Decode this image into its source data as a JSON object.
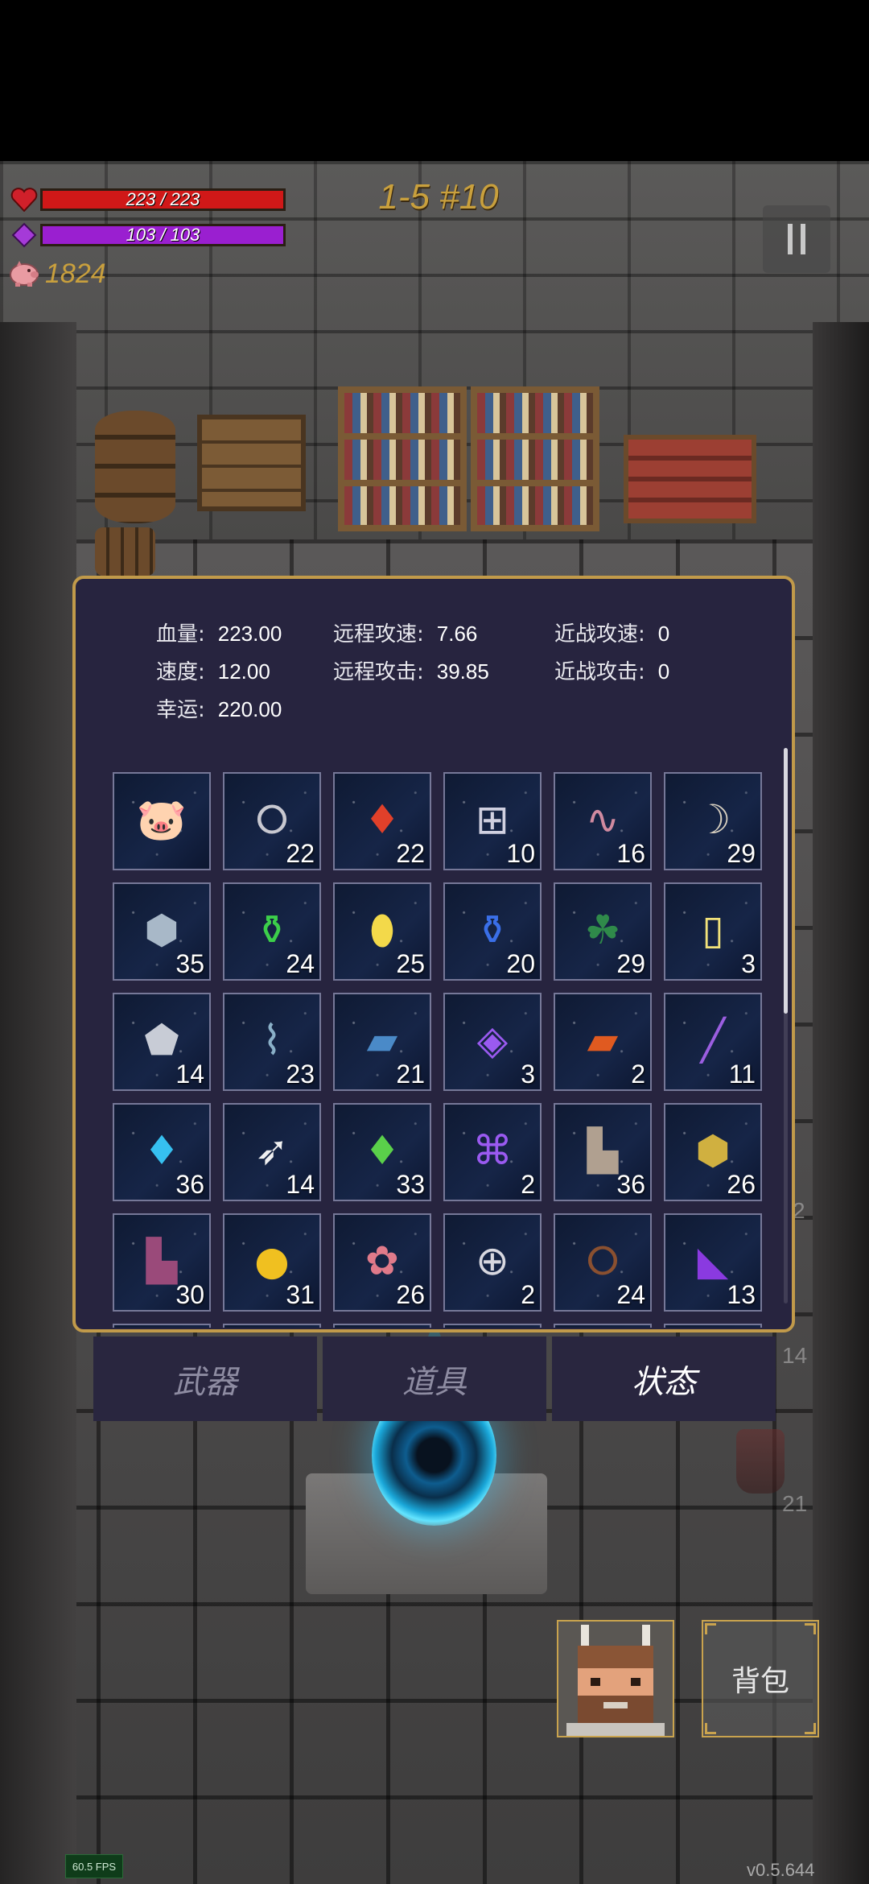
{
  "hud": {
    "hp": {
      "text": "223 / 223",
      "current": 223,
      "max": 223,
      "color": "#d01818"
    },
    "mp": {
      "text": "103 / 103",
      "current": 103,
      "max": 103,
      "color": "#9a1fd0"
    },
    "coins": "1824",
    "level": "1-5 #10"
  },
  "stats": {
    "hp_label": "血量:",
    "hp_value": "223.00",
    "speed_label": "速度:",
    "speed_value": "12.00",
    "luck_label": "幸运:",
    "luck_value": "220.00",
    "ranged_speed_label": "远程攻速:",
    "ranged_speed_value": "7.66",
    "ranged_atk_label": "远程攻击:",
    "ranged_atk_value": "39.85",
    "melee_speed_label": "近战攻速:",
    "melee_speed_value": "0",
    "melee_atk_label": "近战攻击:",
    "melee_atk_value": "0"
  },
  "inventory": [
    {
      "icon": "piggy-bank-icon",
      "glyph": "🐷",
      "count": ""
    },
    {
      "icon": "silver-rings-icon",
      "glyph": "⭘",
      "count": "22"
    },
    {
      "icon": "red-crystal-icon",
      "glyph": "♦",
      "count": "22"
    },
    {
      "icon": "medkit-frame-icon",
      "glyph": "⊞",
      "count": "10"
    },
    {
      "icon": "pink-worm-icon",
      "glyph": "∿",
      "count": "16"
    },
    {
      "icon": "horn-icon",
      "glyph": "☽",
      "count": "29"
    },
    {
      "icon": "grey-rock-icon",
      "glyph": "⬢",
      "count": "35"
    },
    {
      "icon": "green-potion-icon",
      "glyph": "⚱",
      "count": "24"
    },
    {
      "icon": "yellow-crystal-icon",
      "glyph": "⬮",
      "count": "25"
    },
    {
      "icon": "blue-potion-icon",
      "glyph": "⚱",
      "count": "20"
    },
    {
      "icon": "clover-icon",
      "glyph": "☘",
      "count": "29"
    },
    {
      "icon": "yellow-card-icon",
      "glyph": "▯",
      "count": "3"
    },
    {
      "icon": "silver-ore-icon",
      "glyph": "⬟",
      "count": "14"
    },
    {
      "icon": "glass-vial-icon",
      "glyph": "⌇",
      "count": "23"
    },
    {
      "icon": "blue-book-icon",
      "glyph": "▰",
      "count": "21"
    },
    {
      "icon": "purple-rune-eye-icon",
      "glyph": "◈",
      "count": "3"
    },
    {
      "icon": "red-book-icon",
      "glyph": "▰",
      "count": "2"
    },
    {
      "icon": "purple-wand-icon",
      "glyph": "╱",
      "count": "11"
    },
    {
      "icon": "cyan-crystal-icon",
      "glyph": "♦",
      "count": "36"
    },
    {
      "icon": "feather-icon",
      "glyph": "➶",
      "count": "14"
    },
    {
      "icon": "green-crystal-icon",
      "glyph": "♦",
      "count": "33"
    },
    {
      "icon": "purple-rune-icon",
      "glyph": "⌘",
      "count": "2"
    },
    {
      "icon": "boots-icon",
      "glyph": "▙",
      "count": "36"
    },
    {
      "icon": "gold-ore-icon",
      "glyph": "⬢",
      "count": "26"
    },
    {
      "icon": "purple-boots-icon",
      "glyph": "▙",
      "count": "30"
    },
    {
      "icon": "gold-coin-icon",
      "glyph": "●",
      "count": "31"
    },
    {
      "icon": "flower-wreath-icon",
      "glyph": "✿",
      "count": "26"
    },
    {
      "icon": "medkit-ring-icon",
      "glyph": "⊕",
      "count": "2"
    },
    {
      "icon": "thorn-crown-icon",
      "glyph": "⭘",
      "count": "24"
    },
    {
      "icon": "purple-shell-icon",
      "glyph": "◣",
      "count": "13"
    }
  ],
  "slot_colors": [
    "#f2a0b0",
    "#c8c8d0",
    "#e0402a",
    "#d0d0e0",
    "#d08aa0",
    "#d8d0c0",
    "#a8b8c8",
    "#3ccf4a",
    "#f3d94a",
    "#3a6fe8",
    "#2f8a4a",
    "#f2e27a",
    "#c8ccd6",
    "#8ab0c8",
    "#4a8ac8",
    "#9a5af0",
    "#e05a20",
    "#9b5ee0",
    "#36c0f0",
    "#f0f0f0",
    "#5ad04a",
    "#9a5af0",
    "#b0a090",
    "#d0b040",
    "#9a4a7a",
    "#f0c020",
    "#e07a8a",
    "#d8d8e0",
    "#8a5030",
    "#8a3ae0"
  ],
  "tabs": {
    "weapons": "武器",
    "items": "道具",
    "status": "状态"
  },
  "bag_label": "背包",
  "fps": "60.5 FPS",
  "version": "v0.5.644",
  "ghost_numbers": [
    "2",
    "14",
    "21"
  ]
}
